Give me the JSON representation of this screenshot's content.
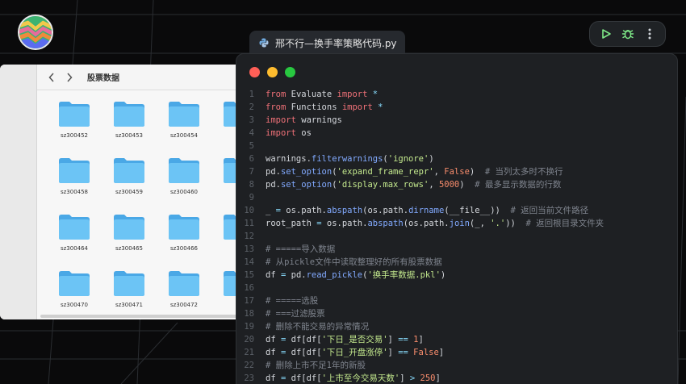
{
  "editor": {
    "tab_title": "邢不行—换手率策略代码.py",
    "lines": [
      {
        "n": "1",
        "tokens": [
          {
            "t": "kw",
            "v": "from"
          },
          {
            "t": "src",
            "v": " Evaluate "
          },
          {
            "t": "kw",
            "v": "import"
          },
          {
            "t": "op",
            "v": " *"
          }
        ]
      },
      {
        "n": "2",
        "tokens": [
          {
            "t": "kw",
            "v": "from"
          },
          {
            "t": "src",
            "v": " Functions "
          },
          {
            "t": "kw",
            "v": "import"
          },
          {
            "t": "op",
            "v": " *"
          }
        ]
      },
      {
        "n": "3",
        "tokens": [
          {
            "t": "kw",
            "v": "import"
          },
          {
            "t": "src",
            "v": " warnings"
          }
        ]
      },
      {
        "n": "4",
        "tokens": [
          {
            "t": "kw",
            "v": "import"
          },
          {
            "t": "src",
            "v": " os"
          }
        ]
      },
      {
        "n": "5",
        "tokens": []
      },
      {
        "n": "6",
        "tokens": [
          {
            "t": "src",
            "v": "warnings."
          },
          {
            "t": "fn",
            "v": "filterwarnings"
          },
          {
            "t": "src",
            "v": "("
          },
          {
            "t": "str",
            "v": "'ignore'"
          },
          {
            "t": "src",
            "v": ")"
          }
        ]
      },
      {
        "n": "7",
        "tokens": [
          {
            "t": "src",
            "v": "pd."
          },
          {
            "t": "fn",
            "v": "set_option"
          },
          {
            "t": "src",
            "v": "("
          },
          {
            "t": "str",
            "v": "'expand_frame_repr'"
          },
          {
            "t": "src",
            "v": ", "
          },
          {
            "t": "num",
            "v": "False"
          },
          {
            "t": "src",
            "v": ")  "
          },
          {
            "t": "cm",
            "v": "# 当列太多时不换行"
          }
        ]
      },
      {
        "n": "8",
        "tokens": [
          {
            "t": "src",
            "v": "pd."
          },
          {
            "t": "fn",
            "v": "set_option"
          },
          {
            "t": "src",
            "v": "("
          },
          {
            "t": "str",
            "v": "'display.max_rows'"
          },
          {
            "t": "src",
            "v": ", "
          },
          {
            "t": "num",
            "v": "5000"
          },
          {
            "t": "src",
            "v": ")  "
          },
          {
            "t": "cm",
            "v": "# 最多显示数据的行数"
          }
        ]
      },
      {
        "n": "9",
        "tokens": []
      },
      {
        "n": "10",
        "tokens": [
          {
            "t": "src",
            "v": "_ "
          },
          {
            "t": "op",
            "v": "="
          },
          {
            "t": "src",
            "v": " os.path."
          },
          {
            "t": "fn",
            "v": "abspath"
          },
          {
            "t": "src",
            "v": "(os.path."
          },
          {
            "t": "fn",
            "v": "dirname"
          },
          {
            "t": "src",
            "v": "(__file__))  "
          },
          {
            "t": "cm",
            "v": "# 返回当前文件路径"
          }
        ]
      },
      {
        "n": "11",
        "tokens": [
          {
            "t": "src",
            "v": "root_path "
          },
          {
            "t": "op",
            "v": "="
          },
          {
            "t": "src",
            "v": " os.path."
          },
          {
            "t": "fn",
            "v": "abspath"
          },
          {
            "t": "src",
            "v": "(os.path."
          },
          {
            "t": "fn",
            "v": "join"
          },
          {
            "t": "src",
            "v": "(_, "
          },
          {
            "t": "str",
            "v": "'.'"
          },
          {
            "t": "src",
            "v": "))  "
          },
          {
            "t": "cm",
            "v": "# 返回根目录文件夹"
          }
        ]
      },
      {
        "n": "12",
        "tokens": []
      },
      {
        "n": "13",
        "tokens": [
          {
            "t": "cm",
            "v": "# =====导入数据"
          }
        ]
      },
      {
        "n": "14",
        "tokens": [
          {
            "t": "cm",
            "v": "# 从pickle文件中读取整理好的所有股票数据"
          }
        ]
      },
      {
        "n": "15",
        "tokens": [
          {
            "t": "src",
            "v": "df "
          },
          {
            "t": "op",
            "v": "="
          },
          {
            "t": "src",
            "v": " pd."
          },
          {
            "t": "fn",
            "v": "read_pickle"
          },
          {
            "t": "src",
            "v": "("
          },
          {
            "t": "str",
            "v": "'换手率数据.pkl'"
          },
          {
            "t": "src",
            "v": ")"
          }
        ]
      },
      {
        "n": "16",
        "tokens": []
      },
      {
        "n": "17",
        "tokens": [
          {
            "t": "cm",
            "v": "# =====选股"
          }
        ]
      },
      {
        "n": "18",
        "tokens": [
          {
            "t": "cm",
            "v": "# ===过滤股票"
          }
        ]
      },
      {
        "n": "19",
        "tokens": [
          {
            "t": "cm",
            "v": "# 删除不能交易的异常情况"
          }
        ]
      },
      {
        "n": "20",
        "tokens": [
          {
            "t": "src",
            "v": "df "
          },
          {
            "t": "op",
            "v": "="
          },
          {
            "t": "src",
            "v": " df[df["
          },
          {
            "t": "str",
            "v": "'下日_是否交易'"
          },
          {
            "t": "src",
            "v": "] "
          },
          {
            "t": "op",
            "v": "=="
          },
          {
            "t": "src",
            "v": " "
          },
          {
            "t": "num",
            "v": "1"
          },
          {
            "t": "src",
            "v": "]"
          }
        ]
      },
      {
        "n": "21",
        "tokens": [
          {
            "t": "src",
            "v": "df "
          },
          {
            "t": "op",
            "v": "="
          },
          {
            "t": "src",
            "v": " df[df["
          },
          {
            "t": "str",
            "v": "'下日_开盘涨停'"
          },
          {
            "t": "src",
            "v": "] "
          },
          {
            "t": "op",
            "v": "=="
          },
          {
            "t": "src",
            "v": " "
          },
          {
            "t": "num",
            "v": "False"
          },
          {
            "t": "src",
            "v": "]"
          }
        ]
      },
      {
        "n": "22",
        "tokens": [
          {
            "t": "cm",
            "v": "# 删除上市不足1年的新股"
          }
        ]
      },
      {
        "n": "23",
        "tokens": [
          {
            "t": "src",
            "v": "df "
          },
          {
            "t": "op",
            "v": "="
          },
          {
            "t": "src",
            "v": " df[df["
          },
          {
            "t": "str",
            "v": "'上市至今交易天数'"
          },
          {
            "t": "src",
            "v": "] "
          },
          {
            "t": "op",
            "v": ">"
          },
          {
            "t": "src",
            "v": " "
          },
          {
            "t": "num",
            "v": "250"
          },
          {
            "t": "src",
            "v": "]"
          }
        ]
      }
    ]
  },
  "finder": {
    "title": "股票数据",
    "folders": [
      "sz300452",
      "sz300453",
      "sz300454",
      "",
      "sz300458",
      "sz300459",
      "sz300460",
      "",
      "sz300464",
      "sz300465",
      "sz300466",
      "",
      "sz300470",
      "sz300471",
      "sz300472",
      ""
    ]
  },
  "icons": {
    "logo": "app-logo",
    "run": "play-icon",
    "debug": "bug-icon",
    "more": "more-vertical-icon",
    "python": "python-icon",
    "folder": "folder-icon"
  },
  "colors": {
    "traffic_red": "#ff5f57",
    "traffic_yellow": "#febc2e",
    "traffic_green": "#28c840",
    "accent_green": "#7ee787",
    "folder_blue": "#5ab8f0"
  }
}
